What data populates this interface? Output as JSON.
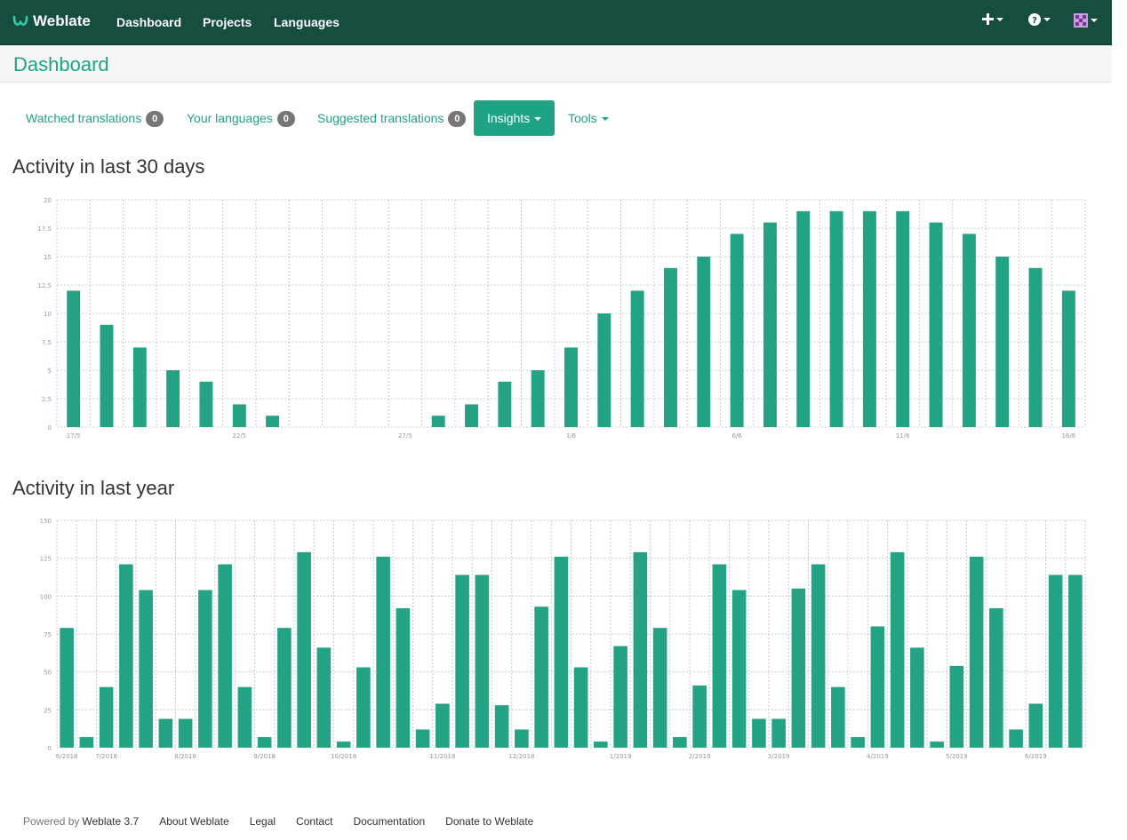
{
  "navbar": {
    "brand": "Weblate",
    "links": [
      "Dashboard",
      "Projects",
      "Languages"
    ],
    "add_icon": "plus-icon",
    "help_icon": "question-circle-icon",
    "user_icon": "avatar-icon"
  },
  "page": {
    "title": "Dashboard"
  },
  "tabs": [
    {
      "label": "Watched translations",
      "count": "0"
    },
    {
      "label": "Your languages",
      "count": "0"
    },
    {
      "label": "Suggested translations",
      "count": "0"
    },
    {
      "label": "Insights"
    },
    {
      "label": "Tools"
    }
  ],
  "colors": {
    "accent": "#1fa385",
    "navbar": "#154d3f",
    "bar": "#21a384"
  },
  "sections": {
    "monthly_title": "Activity in last 30 days",
    "yearly_title": "Activity in last year"
  },
  "chart_data": [
    {
      "type": "bar",
      "title": "Activity in last 30 days",
      "categories": [
        "17/5",
        "18/5",
        "19/5",
        "20/5",
        "21/5",
        "22/5",
        "23/5",
        "24/5",
        "25/5",
        "26/5",
        "27/5",
        "28/5",
        "29/5",
        "30/5",
        "31/5",
        "1/6",
        "2/6",
        "3/6",
        "4/6",
        "5/6",
        "6/6",
        "7/6",
        "8/6",
        "9/6",
        "10/6",
        "11/6",
        "12/6",
        "13/6",
        "14/6",
        "15/6",
        "16/6"
      ],
      "tick_labels": [
        "17/5",
        "22/5",
        "27/5",
        "1/6",
        "6/6",
        "11/6",
        "16/6"
      ],
      "values": [
        12,
        9,
        7,
        5,
        4,
        2,
        1,
        0,
        0,
        0,
        0,
        1,
        2,
        4,
        5,
        7,
        10,
        12,
        14,
        15,
        17,
        18,
        19,
        19,
        19,
        19,
        18,
        17,
        15,
        14,
        12
      ],
      "ylim": [
        0,
        20
      ],
      "yticks": [
        "0",
        "2.5",
        "5",
        "7.5",
        "10",
        "12.5",
        "15",
        "17.5",
        "20"
      ],
      "grid": true
    },
    {
      "type": "bar",
      "title": "Activity in last year",
      "categories": [
        "6/2018",
        "",
        "7/2018",
        "",
        "",
        "",
        "8/2018",
        "",
        "",
        "",
        "9/2018",
        "",
        "",
        "",
        "10/2018",
        "",
        "",
        "",
        "",
        "11/2018",
        "",
        "",
        "",
        "12/2018",
        "",
        "",
        "",
        "",
        "1/2019",
        "",
        "",
        "",
        "2/2019",
        "",
        "",
        "",
        "3/2019",
        "",
        "",
        "",
        "",
        "4/2019",
        "",
        "",
        "",
        "5/2019",
        "",
        "",
        "",
        "6/2019",
        "",
        ""
      ],
      "tick_labels": [
        "6/2018",
        "7/2018",
        "8/2018",
        "9/2018",
        "10/2018",
        "11/2018",
        "12/2018",
        "1/2019",
        "2/2019",
        "3/2019",
        "4/2019",
        "5/2019",
        "6/2019"
      ],
      "values": [
        79,
        7,
        40,
        121,
        104,
        19,
        19,
        104,
        121,
        40,
        7,
        79,
        129,
        66,
        4,
        53,
        126,
        92,
        12,
        29,
        114,
        114,
        28,
        12,
        93,
        126,
        53,
        4,
        67,
        129,
        79,
        7,
        41,
        121,
        104,
        19,
        19,
        105,
        121,
        40,
        7,
        80,
        129,
        66,
        4,
        54,
        126,
        92,
        12,
        29,
        114,
        114
      ],
      "ylim": [
        0,
        150
      ],
      "yticks": [
        "0",
        "25",
        "50",
        "75",
        "100",
        "125",
        "150"
      ],
      "grid": true
    }
  ],
  "footer": {
    "powered_by": "Powered by",
    "version": "Weblate 3.7",
    "links": [
      "About Weblate",
      "Legal",
      "Contact",
      "Documentation",
      "Donate to Weblate"
    ]
  }
}
